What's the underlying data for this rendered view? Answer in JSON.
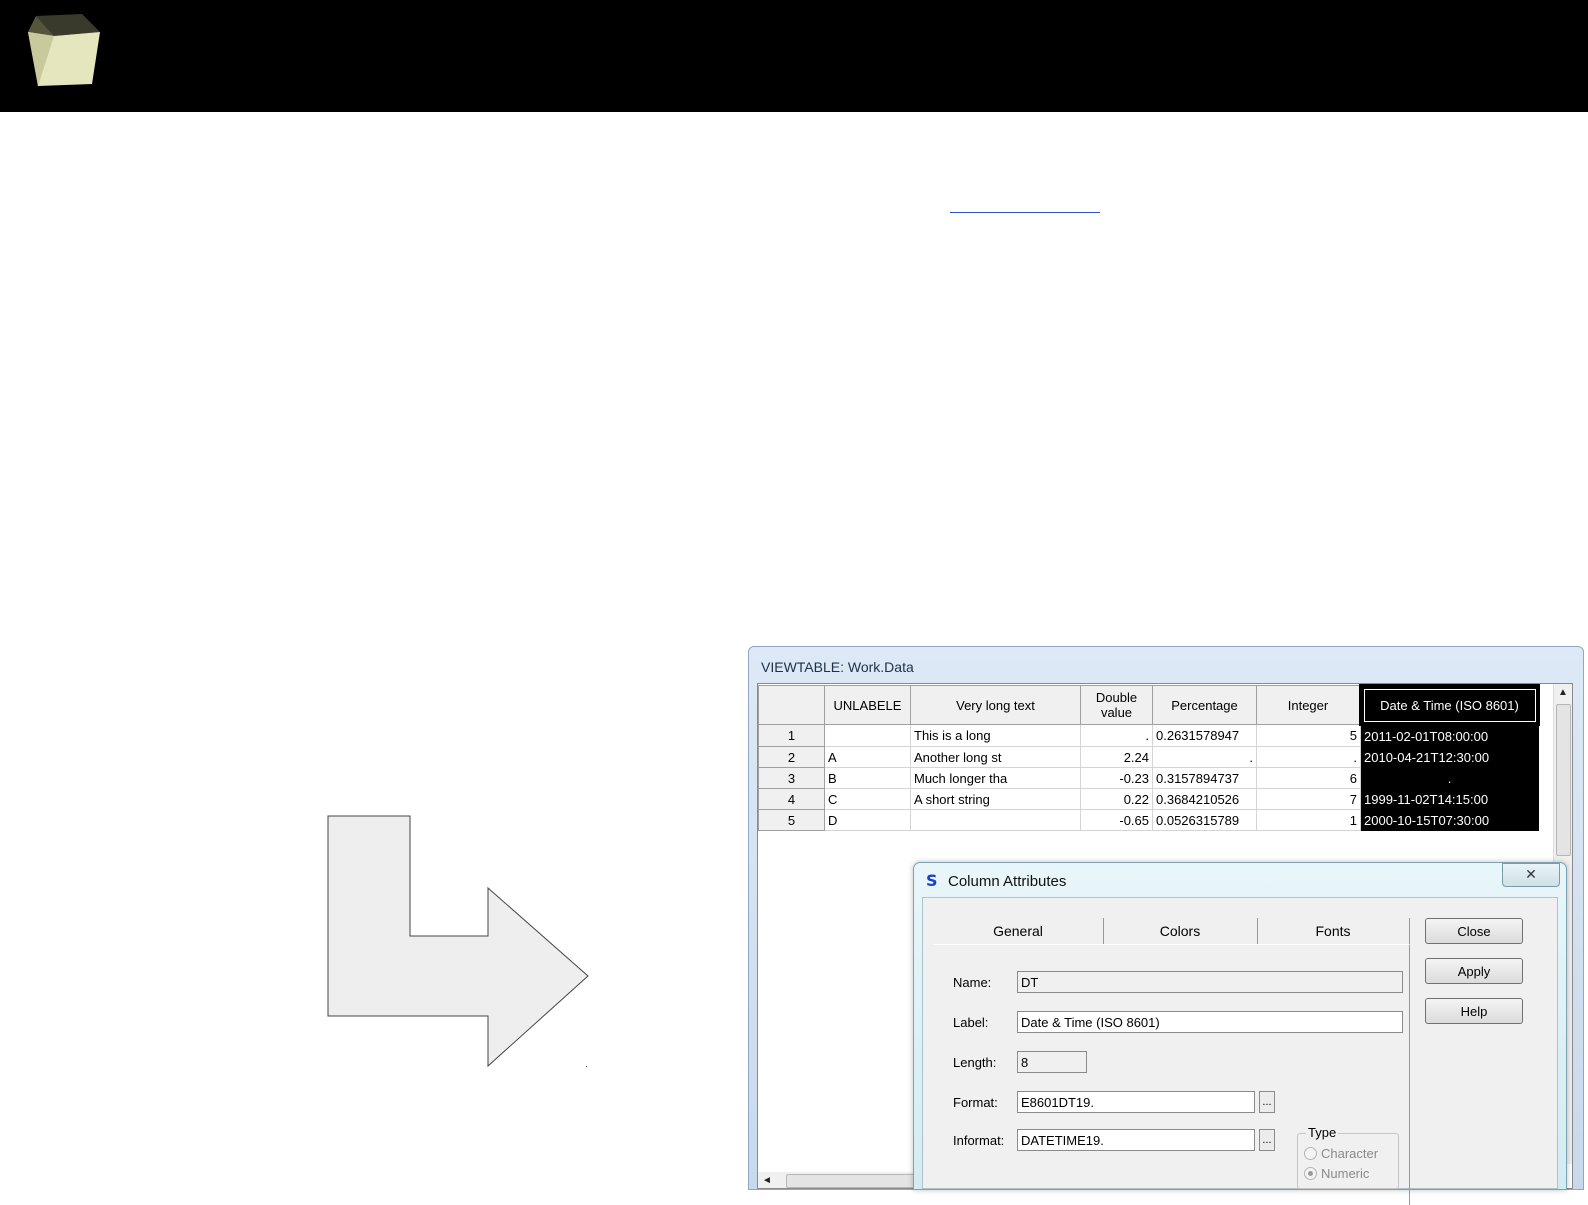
{
  "viewtable": {
    "title": "VIEWTABLE: Work.Data",
    "columns": [
      "",
      "UNLABELE",
      "Very long text",
      "Double value",
      "Percentage",
      "Integer",
      "Date & Time (ISO 8601)"
    ],
    "rows": [
      [
        "1",
        "",
        "This is a long",
        ".",
        "0.2631578947",
        "5",
        "2011-02-01T08:00:00"
      ],
      [
        "2",
        "A",
        "Another long st",
        "2.24",
        ".",
        ".",
        "2010-04-21T12:30:00"
      ],
      [
        "3",
        "B",
        "Much longer tha",
        "-0.23",
        "0.3157894737",
        "6",
        "."
      ],
      [
        "4",
        "C",
        "A short string",
        "0.22",
        "0.3684210526",
        "7",
        "1999-11-02T14:15:00"
      ],
      [
        "5",
        "D",
        "",
        "-0.65",
        "0.0526315789",
        "1",
        "2000-10-15T07:30:00"
      ]
    ],
    "scroll_up_icon": "▲",
    "scroll_left_icon": "◄"
  },
  "dialog": {
    "title": "Column Attributes",
    "app_icon": "S",
    "close_icon": "✕",
    "tabs": [
      "General",
      "Colors",
      "Fonts"
    ],
    "fields": {
      "name_label": "Name:",
      "name_value": "DT",
      "label_label": "Label:",
      "label_value": "Date & Time (ISO 8601)",
      "length_label": "Length:",
      "length_value": "8",
      "format_label": "Format:",
      "format_value": "E8601DT19.",
      "informat_label": "Informat:",
      "informat_value": "DATETIME19.",
      "ellipsis": "..."
    },
    "type": {
      "legend": "Type",
      "options": [
        "Character",
        "Numeric"
      ],
      "selected": "Numeric"
    },
    "buttons": {
      "close": "Close",
      "apply": "Apply",
      "help": "Help"
    }
  },
  "colors": {
    "banner": "#000000",
    "selection": "#000000",
    "cube_face": "#e6e6be"
  }
}
